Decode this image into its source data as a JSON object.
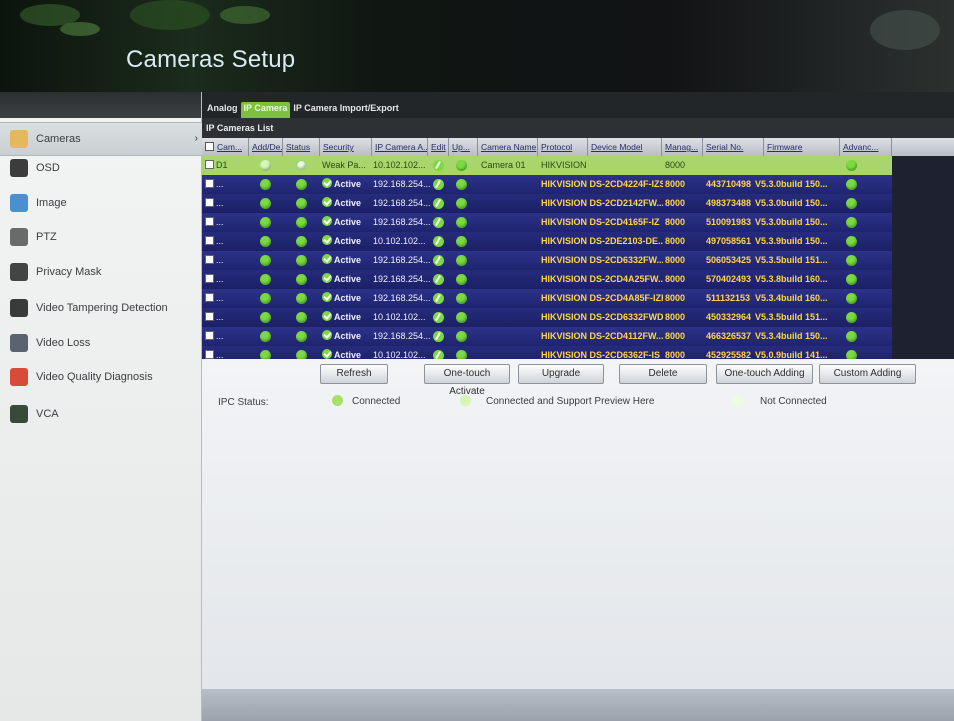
{
  "header": {
    "title": "Cameras Setup"
  },
  "sidebar": {
    "items": [
      {
        "label": "Cameras",
        "icon": "camera-icon",
        "color": "#e6b85c",
        "active": true
      },
      {
        "label": "OSD",
        "icon": "osd-icon",
        "color": "#3c3c3c"
      },
      {
        "label": "Image",
        "icon": "image-icon",
        "color": "#4a8fd0"
      },
      {
        "label": "PTZ",
        "icon": "ptz-icon",
        "color": "#6a6a6a"
      },
      {
        "label": "Privacy Mask",
        "icon": "privacy-mask-icon",
        "color": "#444444"
      },
      {
        "label": "Video Tampering Detection",
        "icon": "tampering-icon",
        "color": "#3a3a3a"
      },
      {
        "label": "Video Loss",
        "icon": "video-loss-icon",
        "color": "#5a6470"
      },
      {
        "label": "Video Quality Diagnosis",
        "icon": "quality-icon",
        "color": "#d84a3a"
      },
      {
        "label": "VCA",
        "icon": "vca-icon",
        "color": "#3a4a3a"
      }
    ]
  },
  "tabs": [
    "Analog",
    "IP Camera",
    "IP Camera Import/Export"
  ],
  "list_title": "IP Cameras List",
  "columns": [
    "Cam...",
    "Add/De...",
    "Status",
    "Security",
    "IP Camera A...",
    "Edit",
    "Up...",
    "Camera Name",
    "Protocol",
    "Device Model",
    "Manag...",
    "Serial No.",
    "Firmware",
    "Advanc..."
  ],
  "rows": [
    {
      "cam": "D1",
      "security": "Weak Pa...",
      "ip": "10.102.102...",
      "name": "Camera 01",
      "protocol": "HIKVISION",
      "model": "",
      "port": "8000",
      "serial": "",
      "firmware": ""
    },
    {
      "cam": "...",
      "security": "Active",
      "ip": "192.168.254...",
      "name": "",
      "protocol": "HIKVISION",
      "model": "DS-2CD4224F-IZS",
      "port": "8000",
      "serial": "443710498",
      "firmware": "V5.3.0build 150..."
    },
    {
      "cam": "...",
      "security": "Active",
      "ip": "192.168.254...",
      "name": "",
      "protocol": "HIKVISION",
      "model": "DS-2CD2142FW...",
      "port": "8000",
      "serial": "498373488",
      "firmware": "V5.3.0build 150..."
    },
    {
      "cam": "...",
      "security": "Active",
      "ip": "192.168.254...",
      "name": "",
      "protocol": "HIKVISION",
      "model": "DS-2CD4165F-IZ",
      "port": "8000",
      "serial": "510091983",
      "firmware": "V5.3.0build 150..."
    },
    {
      "cam": "...",
      "security": "Active",
      "ip": "10.102.102...",
      "name": "",
      "protocol": "HIKVISION",
      "model": "DS-2DE2103-DE...",
      "port": "8000",
      "serial": "497058561",
      "firmware": "V5.3.9build 150..."
    },
    {
      "cam": "...",
      "security": "Active",
      "ip": "192.168.254...",
      "name": "",
      "protocol": "HIKVISION",
      "model": "DS-2CD6332FW...",
      "port": "8000",
      "serial": "506053425",
      "firmware": "V5.3.5build 151..."
    },
    {
      "cam": "...",
      "security": "Active",
      "ip": "192.168.254...",
      "name": "",
      "protocol": "HIKVISION",
      "model": "DS-2CD4A25FW...",
      "port": "8000",
      "serial": "570402493",
      "firmware": "V5.3.8build 160..."
    },
    {
      "cam": "...",
      "security": "Active",
      "ip": "192.168.254...",
      "name": "",
      "protocol": "HIKVISION",
      "model": "DS-2CD4A85F-IZH",
      "port": "8000",
      "serial": "511132153",
      "firmware": "V5.3.4build 160..."
    },
    {
      "cam": "...",
      "security": "Active",
      "ip": "10.102.102...",
      "name": "",
      "protocol": "HIKVISION",
      "model": "DS-2CD6332FWD-I",
      "port": "8000",
      "serial": "450332964",
      "firmware": "V5.3.5build 151..."
    },
    {
      "cam": "...",
      "security": "Active",
      "ip": "192.168.254...",
      "name": "",
      "protocol": "HIKVISION",
      "model": "DS-2CD4112FW...",
      "port": "8000",
      "serial": "466326537",
      "firmware": "V5.3.4build 150..."
    },
    {
      "cam": "...",
      "security": "Active",
      "ip": "10.102.102...",
      "name": "",
      "protocol": "HIKVISION",
      "model": "DS-2CD6362F-IS",
      "port": "8000",
      "serial": "452925582",
      "firmware": "V5.0.9build 141..."
    }
  ],
  "buttons": [
    "Refresh",
    "One-touch Activate",
    "Upgrade",
    "Delete",
    "One-touch Adding",
    "Custom Adding"
  ],
  "ipc_status": {
    "label": "IPC Status:",
    "legend": [
      {
        "text": "Connected",
        "color": "#a8e06a"
      },
      {
        "text": "Connected and Support Preview Here",
        "color": "#d8f5b8"
      },
      {
        "text": "Not Connected",
        "color": "#ecfce0"
      }
    ]
  }
}
